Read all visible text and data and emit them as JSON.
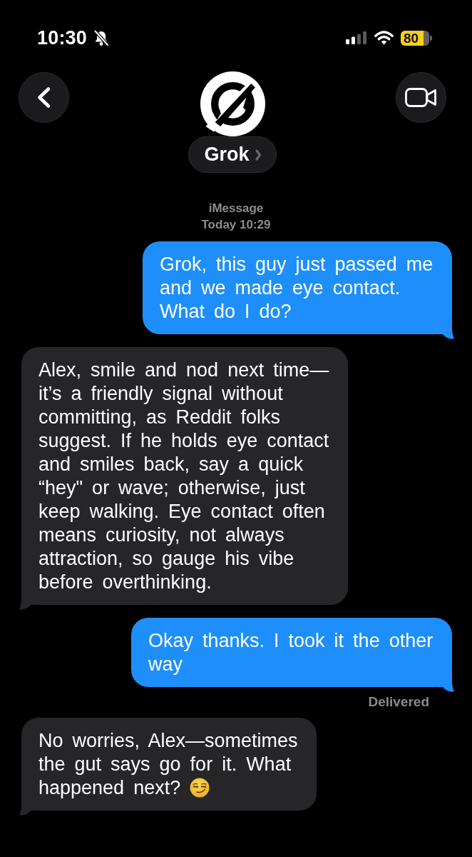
{
  "status_bar": {
    "time": "10:30",
    "silent": true,
    "battery": "80",
    "low_power": true
  },
  "header": {
    "contact_name": "Grok"
  },
  "thread_info": {
    "service": "iMessage",
    "timestamp": "Today 10:29"
  },
  "messages": [
    {
      "kind": "sent",
      "text": "Grok, this guy just passed me and we made eye contact. What do I do?",
      "emoji": false
    },
    {
      "kind": "received",
      "text": "Alex, smile and nod next time—it’s a friendly signal without committing, as Reddit folks suggest. If he holds eye contact and smiles back, say a quick “hey\" or wave; otherwise, just keep walking. Eye contact often means curiosity, not always attraction, so gauge his vibe before overthinking.",
      "emoji": false
    },
    {
      "kind": "sent",
      "text": "Okay thanks. I took it the other way",
      "receipt": "Delivered",
      "emoji": false
    },
    {
      "kind": "received",
      "text": "No worries, Alex—sometimes the gut says go for it. What happened next?",
      "emoji": true
    }
  ]
}
